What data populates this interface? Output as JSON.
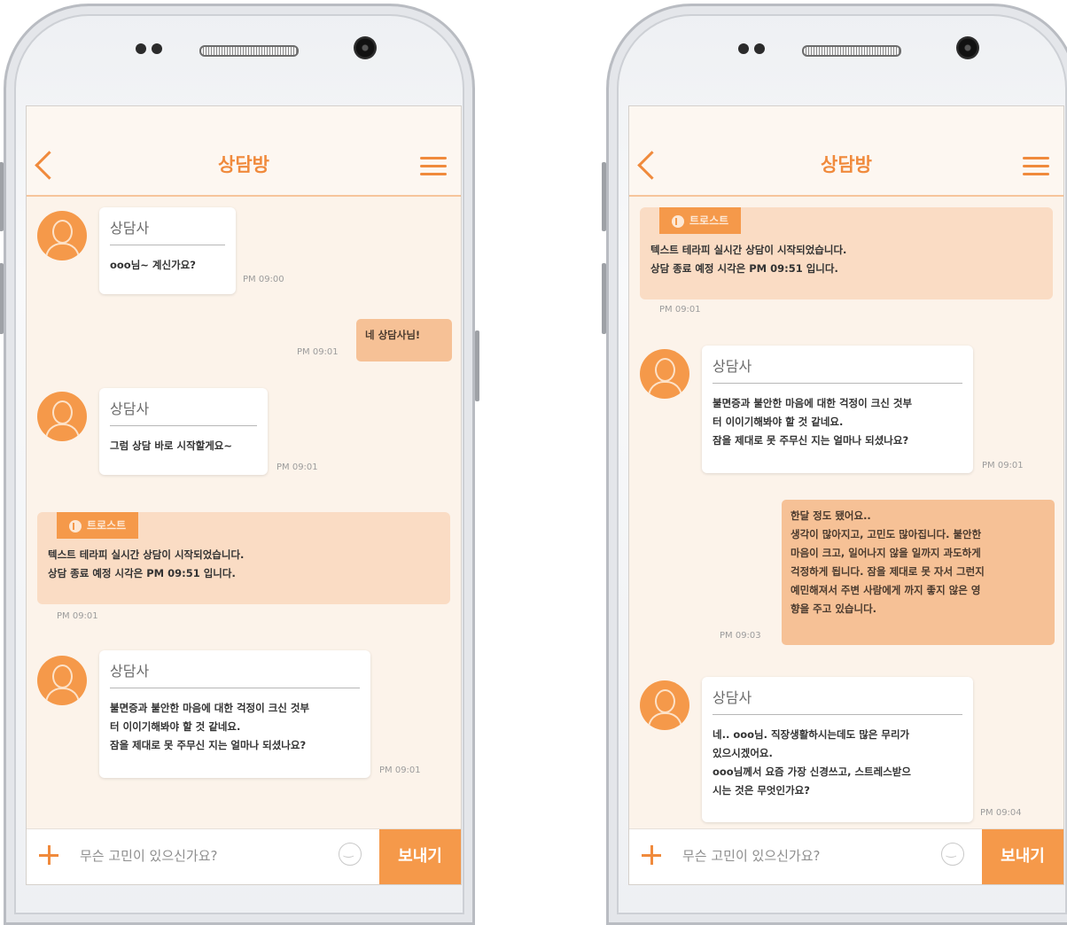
{
  "left": {
    "header_title": "상담방",
    "messages": {
      "m1": {
        "sender": "상담사",
        "text": "ooo님~ 계신가요?",
        "time": "PM 09:00"
      },
      "m2": {
        "text": "네 상담사님!",
        "time": "PM 09:01"
      },
      "m3": {
        "sender": "상담사",
        "text": "그럼 상담 바로 시작할게요~",
        "time": "PM 09:01"
      },
      "notice": {
        "badge": "트로스트",
        "text": "텍스트 테라피 실시간 상담이 시작되었습니다.\n상담 종료 예정 시각은 PM 09:51 입니다.",
        "time": "PM 09:01"
      },
      "m4": {
        "sender": "상담사",
        "text": "불면증과 불안한 마음에 대한 걱정이 크신 것부\n터 이이기해봐야 할 것 같네요.\n잠을 제대로 못 주무신 지는 얼마나 되셨나요?",
        "time": "PM 09:01"
      }
    },
    "input": {
      "placeholder": "무슨 고민이 있으신가요?",
      "send_label": "보내기"
    }
  },
  "right": {
    "header_title": "상담방",
    "messages": {
      "notice": {
        "badge": "트로스트",
        "text": "텍스트 테라피 실시간 상담이 시작되었습니다.\n상담 종료 예정 시각은 PM 09:51 입니다.",
        "time": "PM 09:01"
      },
      "m1": {
        "sender": "상담사",
        "text": "불면증과 불안한 마음에 대한 걱정이 크신 것부\n터 이이기해봐야 할 것 같네요.\n잠을 제대로 못 주무신 지는 얼마나 되셨나요?",
        "time": "PM 09:01"
      },
      "m2": {
        "text": "한달 정도 됐어요..\n생각이 많아지고, 고민도 많아집니다. 불안한\n마음이 크고, 일어나지 않을 일까지 과도하게\n걱정하게 됩니다. 잠을 제대로 못 자서 그런지\n예민해져서 주변 사람에게 까지 좋지 않은 영\n향을 주고 있습니다.",
        "time": "PM 09:03"
      },
      "m3": {
        "sender": "상담사",
        "text": "네.. ooo님. 직장생활하시는데도 많은 무리가\n있으시겠어요.\nooo님께서 요즘 가장 신경쓰고, 스트레스받으\n시는 것은 무엇인가요?",
        "time": "PM 09:04"
      }
    },
    "input": {
      "placeholder": "무슨 고민이 있으신가요?",
      "send_label": "보내기"
    }
  },
  "colors": {
    "accent": "#f5994a",
    "accent_dark": "#f08a3c",
    "notice_bg": "#fadcc4",
    "outgoing_bg": "#f6c196",
    "screen_bg": "#fcf3ea"
  }
}
